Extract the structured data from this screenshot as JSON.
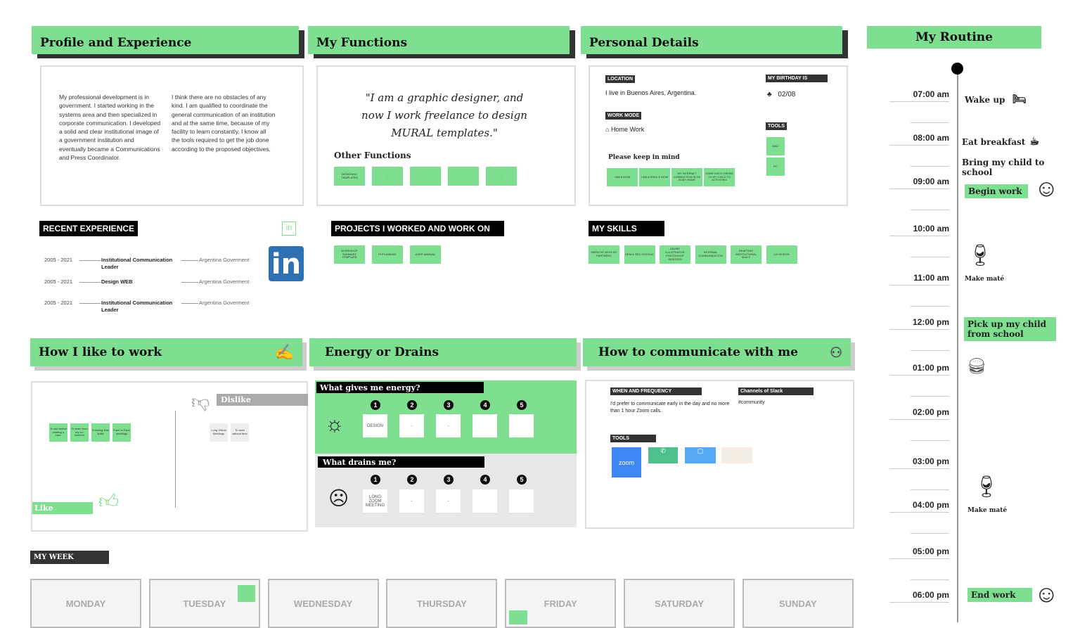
{
  "colors": {
    "accent": "#7ddf8f",
    "dark": "#111111",
    "gray": "#eeeeee"
  },
  "profile": {
    "title": "Profile and Experience",
    "para1": "My professional development is in government. I started working in the systems area and then specialized in corporate communication. I developed a solid and clear institutional image of a government institution and eventually became a Communications and Press Coordinator.",
    "para2": "I think there are no obstacles of any kind. I am qualified to coordinate the general communication of an institution and at the same time, because of my facility to learn constantly, I know all the tools required to get the job done according to the proposed objectives.",
    "recent_label": "RECENT EXPERIENCE",
    "linkedin_icon": "linkedin-icon",
    "linkedin_text": "in",
    "experience": [
      {
        "years": "2005 - 2021",
        "role": "Institutional Communication Leader",
        "org": "Argentina Goverment"
      },
      {
        "years": "2005 - 2021",
        "role": "Design WEB",
        "org": "Argentina Goverment"
      },
      {
        "years": "2005 - 2021",
        "role": "Institutional Communication Leader",
        "org": "Argentina Goverment"
      }
    ]
  },
  "functions": {
    "title": "My Functions",
    "quote": "\"I am a graphic designer, and now I work freelance to design MURAL templates.\"",
    "other_label": "Other Functions",
    "other": [
      "DESIGNING TEMPLATES",
      "-",
      "-",
      "-",
      "-"
    ],
    "projects_label": "PROJECTS I WORKED AND WORK ON",
    "projects": [
      "WORKSHOP SUMMARY TEMPLATE",
      "PI PLANNING",
      "USER MANUAL"
    ]
  },
  "personal": {
    "title": "Personal Details",
    "location_label": "LOCATION",
    "location": "I live in Buenos Aires, Argentina.",
    "work_mode_label": "WORK MODE",
    "work_mode": "Home Work",
    "birthday_label": "MY BIRTHDAY IS",
    "birthday": "02/08",
    "tools_label": "TOOLS",
    "tools": [
      "Mac",
      "PC"
    ],
    "keep_label": "Please keep in mind",
    "keep": [
      "I AM A MOM",
      "I AM A SINGLE MOM",
      "MY INTERNET CONNECTION IS OK IN MY HOME",
      "SOME DAYS I BRING TO MY CHILD TO ACTIVITIES"
    ],
    "skills_label": "MY SKILLS",
    "skills": [
      "EMPATHY WITH MY PARTNERS",
      "SEM & SEO GOOGLE",
      "ADOBE ILLUSTRATOR PHOTOSHOP INDESIGN",
      "INTERNAL COMMUNICATION",
      "DRAFTING INSTITUTIONAL MAILS",
      "UX DESIGN"
    ]
  },
  "work": {
    "title": "How I like to work",
    "like": "Like",
    "dislike": "Dislike",
    "likes": [
      "To ask before starting a task",
      "To learn from my co-workers",
      "Knowing time limits",
      "Face to Face meetings"
    ],
    "dislikes": [
      "Long Virtual Meetings",
      "To work without time"
    ]
  },
  "energy": {
    "title": "Energy or  Drains",
    "gives_label": "What gives me energy?",
    "gives": [
      "DESIGN",
      "-",
      "-",
      "",
      ""
    ],
    "drains_label": "What drains me?",
    "drains": [
      "LONG ZOOM MEETING",
      "-",
      "-",
      "",
      ""
    ],
    "numbers": [
      "1",
      "2",
      "3",
      "4",
      "5"
    ]
  },
  "communicate": {
    "title": "How to communicate with me",
    "when_label": "WHEN AND FREQUENCY",
    "when": "I'd prefer to communicate early in the day and no more than 1 hour Zoom calls.",
    "slack_label": "Channels of Slack",
    "slack": "#community",
    "tools_label": "TOOLS",
    "zoom": "zoom"
  },
  "week": {
    "label": "MY WEEK",
    "days": [
      "MONDAY",
      "TUESDAY",
      "WEDNESDAY",
      "THURSDAY",
      "FRIDAY",
      "SATURDAY",
      "SUNDAY"
    ]
  },
  "routine": {
    "title": "My Routine",
    "times": [
      "07:00 am",
      "08:00 am",
      "09:00 am",
      "10:00 am",
      "11:00 am",
      "12:00 pm",
      "01:00 pm",
      "02:00 pm",
      "03:00 pm",
      "04:00 pm",
      "05:00 pm",
      "06:00 pm"
    ],
    "wake": "Wake up",
    "breakfast": "Eat breakfast",
    "child": "Bring my child to school",
    "begin": "Begin work",
    "mate1": "Make maté",
    "pickup": "Pick up my child from school",
    "mate2": "Make maté",
    "end": "End work"
  }
}
